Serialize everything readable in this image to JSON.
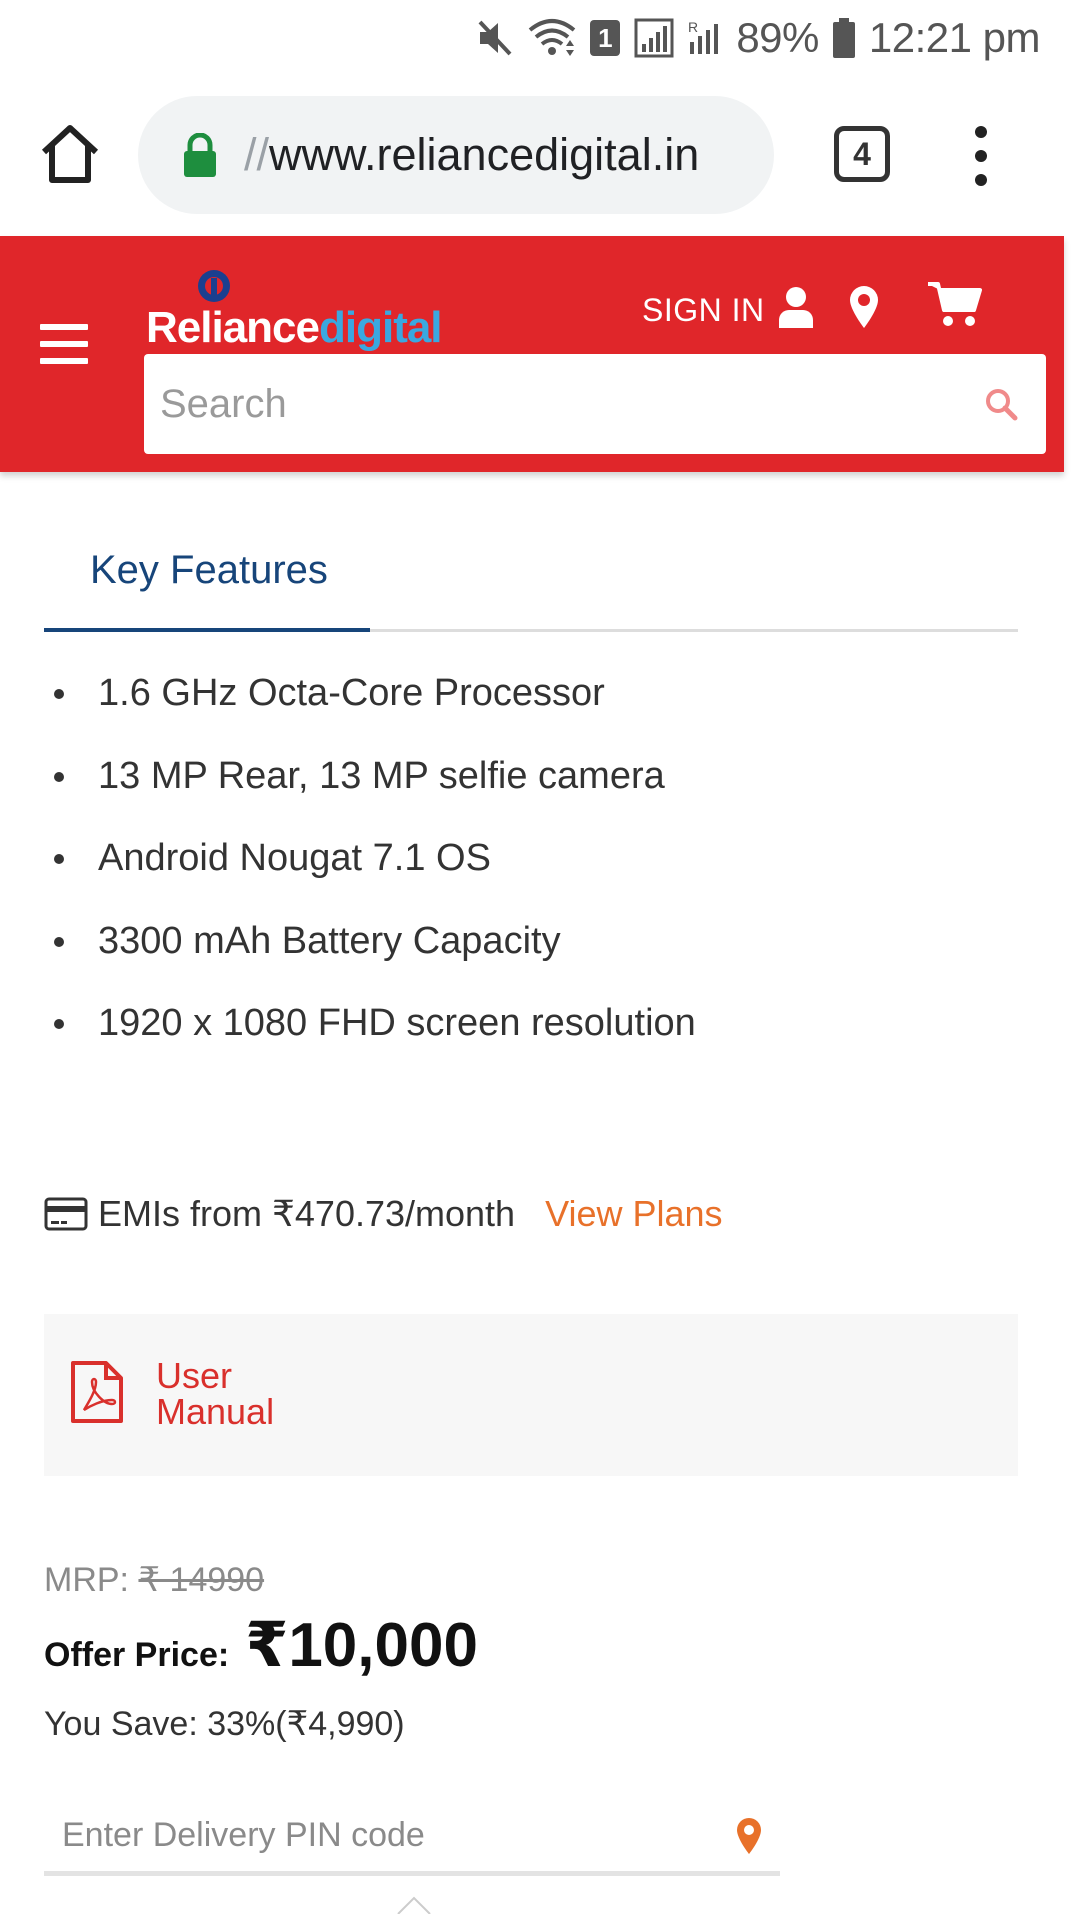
{
  "status_bar": {
    "battery": "89%",
    "time": "12:21 pm",
    "sim_badge": "1",
    "icons": [
      "mute-icon",
      "wifi-icon",
      "sim-badge-icon",
      "signal-icon",
      "roaming-signal-icon",
      "battery-icon"
    ]
  },
  "browser": {
    "url_scheme": "//",
    "url_host": "www.reliancedigital.in",
    "tab_count": "4",
    "icons": [
      "home-icon",
      "lock-icon",
      "tabs-icon",
      "overflow-menu-icon"
    ]
  },
  "header": {
    "logo_part1": "Reliance",
    "logo_part2": "digital",
    "sign_in": "SIGN IN",
    "search_placeholder": "Search",
    "icons": [
      "hamburger-icon",
      "user-icon",
      "location-pin-icon",
      "cart-icon",
      "search-icon"
    ],
    "colors": {
      "background": "#e0262a",
      "logo_accent": "#3aa8e0"
    }
  },
  "features": {
    "tab_label": "Key Features",
    "items": [
      "1.6 GHz Octa-Core Processor",
      "13 MP Rear, 13 MP selfie camera",
      "Android Nougat 7.1 OS",
      "3300 mAh Battery Capacity",
      "1920 x 1080 FHD screen resolution"
    ],
    "colors": {
      "tab_accent": "#17457a"
    }
  },
  "emi": {
    "text": "EMIs from ₹470.73/month",
    "link": "View Plans",
    "colors": {
      "link": "#e8712a"
    }
  },
  "manual": {
    "label": "User Manual",
    "colors": {
      "accent": "#d9302c"
    }
  },
  "price": {
    "mrp_label": "MRP:",
    "mrp_value": "₹ 14990",
    "offer_label": "Offer Price:",
    "offer_value": "₹10,000",
    "save_text": "You Save: 33%(₹4,990)"
  },
  "delivery": {
    "pin_placeholder": "Enter Delivery PIN code"
  }
}
